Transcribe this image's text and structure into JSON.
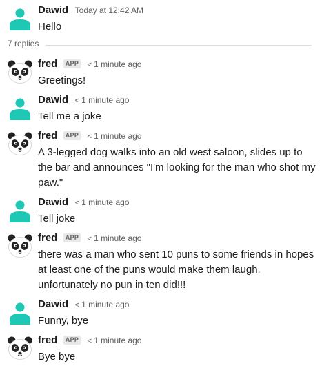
{
  "colors": {
    "user_avatar": "#1fc7b5",
    "panda_black": "#222222",
    "timestamp": "#616061",
    "divider": "#dddddd"
  },
  "parent": {
    "author": "Dawid",
    "timestamp": "Today at 12:42 AM",
    "text": "Hello",
    "avatar_icon": "person-avatar-icon"
  },
  "thread": {
    "replies_label": "7 replies"
  },
  "replies": [
    {
      "author": "fred",
      "badge": "APP",
      "time": "1 minute ago",
      "text": "Greetings!",
      "avatar_icon": "panda-avatar-icon"
    },
    {
      "author": "Dawid",
      "badge": "",
      "time": "1 minute ago",
      "text": "Tell me a joke",
      "avatar_icon": "person-avatar-icon"
    },
    {
      "author": "fred",
      "badge": "APP",
      "time": "1 minute ago",
      "text": "A 3-legged dog walks into an old west saloon, slides up to the bar and announces \"I'm looking for the man who shot my paw.\"",
      "avatar_icon": "panda-avatar-icon"
    },
    {
      "author": "Dawid",
      "badge": "",
      "time": "1 minute ago",
      "text": "Tell joke",
      "avatar_icon": "person-avatar-icon"
    },
    {
      "author": "fred",
      "badge": "APP",
      "time": "1 minute ago",
      "text": "there was a man who sent 10 puns to some friends in hopes at least one of the puns would make them laugh. unfortunately no pun in ten did!!!",
      "avatar_icon": "panda-avatar-icon"
    },
    {
      "author": "Dawid",
      "badge": "",
      "time": "1 minute ago",
      "text": "Funny, bye",
      "avatar_icon": "person-avatar-icon"
    },
    {
      "author": "fred",
      "badge": "APP",
      "time": "1 minute ago",
      "text": "Bye bye",
      "avatar_icon": "panda-avatar-icon"
    }
  ]
}
